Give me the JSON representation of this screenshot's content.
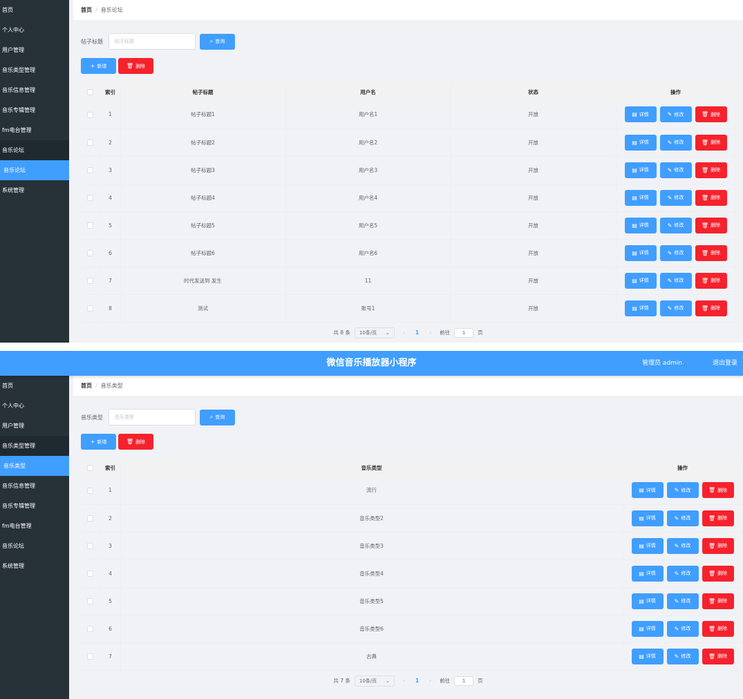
{
  "app": {
    "title": "微信音乐播放器小程序",
    "user_label": "管理员 admin",
    "logout": "退出登录"
  },
  "buttons": {
    "search": "查询",
    "add": "新增",
    "delete": "删除",
    "detail": "详情",
    "edit": "修改"
  },
  "icons": {
    "search": "search-icon",
    "add": "plus-icon",
    "delete": "trash-icon",
    "detail": "document-icon",
    "edit": "pencil-icon"
  },
  "colors": {
    "primary": "#409eff",
    "danger": "#f5222d",
    "sidebar": "#263238"
  },
  "panel1": {
    "menu": [
      {
        "label": "首页"
      },
      {
        "label": "个人中心"
      },
      {
        "label": "用户管理"
      },
      {
        "label": "音乐类型管理"
      },
      {
        "label": "音乐信息管理"
      },
      {
        "label": "音乐专辑管理"
      },
      {
        "label": "fm电台管理"
      },
      {
        "label": "音乐论坛"
      },
      {
        "label": "音乐论坛"
      },
      {
        "label": "系统管理"
      }
    ],
    "breadcrumb": {
      "home": "首页",
      "sep": "/",
      "current": "音乐论坛"
    },
    "search": {
      "label": "帖子标题",
      "placeholder": "帖子标题"
    },
    "table": {
      "headers": [
        "索引",
        "帖子标题",
        "用户名",
        "状态",
        "操作"
      ],
      "rows": [
        {
          "index": "1",
          "title": "帖子标题1",
          "user": "用户名1",
          "status": "开放"
        },
        {
          "index": "2",
          "title": "帖子标题2",
          "user": "用户名2",
          "status": "开放"
        },
        {
          "index": "3",
          "title": "帖子标题3",
          "user": "用户名3",
          "status": "开放"
        },
        {
          "index": "4",
          "title": "帖子标题4",
          "user": "用户名4",
          "status": "开放"
        },
        {
          "index": "5",
          "title": "帖子标题5",
          "user": "用户名5",
          "status": "开放"
        },
        {
          "index": "6",
          "title": "帖子标题6",
          "user": "用户名6",
          "status": "开放"
        },
        {
          "index": "7",
          "title": "时代发送到 发生",
          "user": "11",
          "status": "开放"
        },
        {
          "index": "8",
          "title": "测试",
          "user": "账号1",
          "status": "开放"
        }
      ]
    },
    "pager": {
      "total": "共 8 条",
      "size": "10条/页",
      "page": "1",
      "goto": "前往",
      "goto_value": "1",
      "unit": "页"
    }
  },
  "panel2": {
    "menu": [
      {
        "label": "首页"
      },
      {
        "label": "个人中心"
      },
      {
        "label": "用户管理"
      },
      {
        "label": "音乐类型管理"
      },
      {
        "label": "音乐类型"
      },
      {
        "label": "音乐信息管理"
      },
      {
        "label": "音乐专辑管理"
      },
      {
        "label": "fm电台管理"
      },
      {
        "label": "音乐论坛"
      },
      {
        "label": "系统管理"
      }
    ],
    "breadcrumb": {
      "home": "首页",
      "sep": "/",
      "current": "音乐类型"
    },
    "search": {
      "label": "音乐类型",
      "placeholder": "音乐类型"
    },
    "table": {
      "headers": [
        "索引",
        "音乐类型",
        "操作"
      ],
      "rows": [
        {
          "index": "1",
          "type": "流行"
        },
        {
          "index": "2",
          "type": "音乐类型2"
        },
        {
          "index": "3",
          "type": "音乐类型3"
        },
        {
          "index": "4",
          "type": "音乐类型4"
        },
        {
          "index": "5",
          "type": "音乐类型5"
        },
        {
          "index": "6",
          "type": "音乐类型6"
        },
        {
          "index": "7",
          "type": "古典"
        }
      ]
    },
    "pager": {
      "total": "共 7 条",
      "size": "10条/页",
      "page": "1",
      "goto": "前往",
      "goto_value": "1",
      "unit": "页"
    }
  }
}
